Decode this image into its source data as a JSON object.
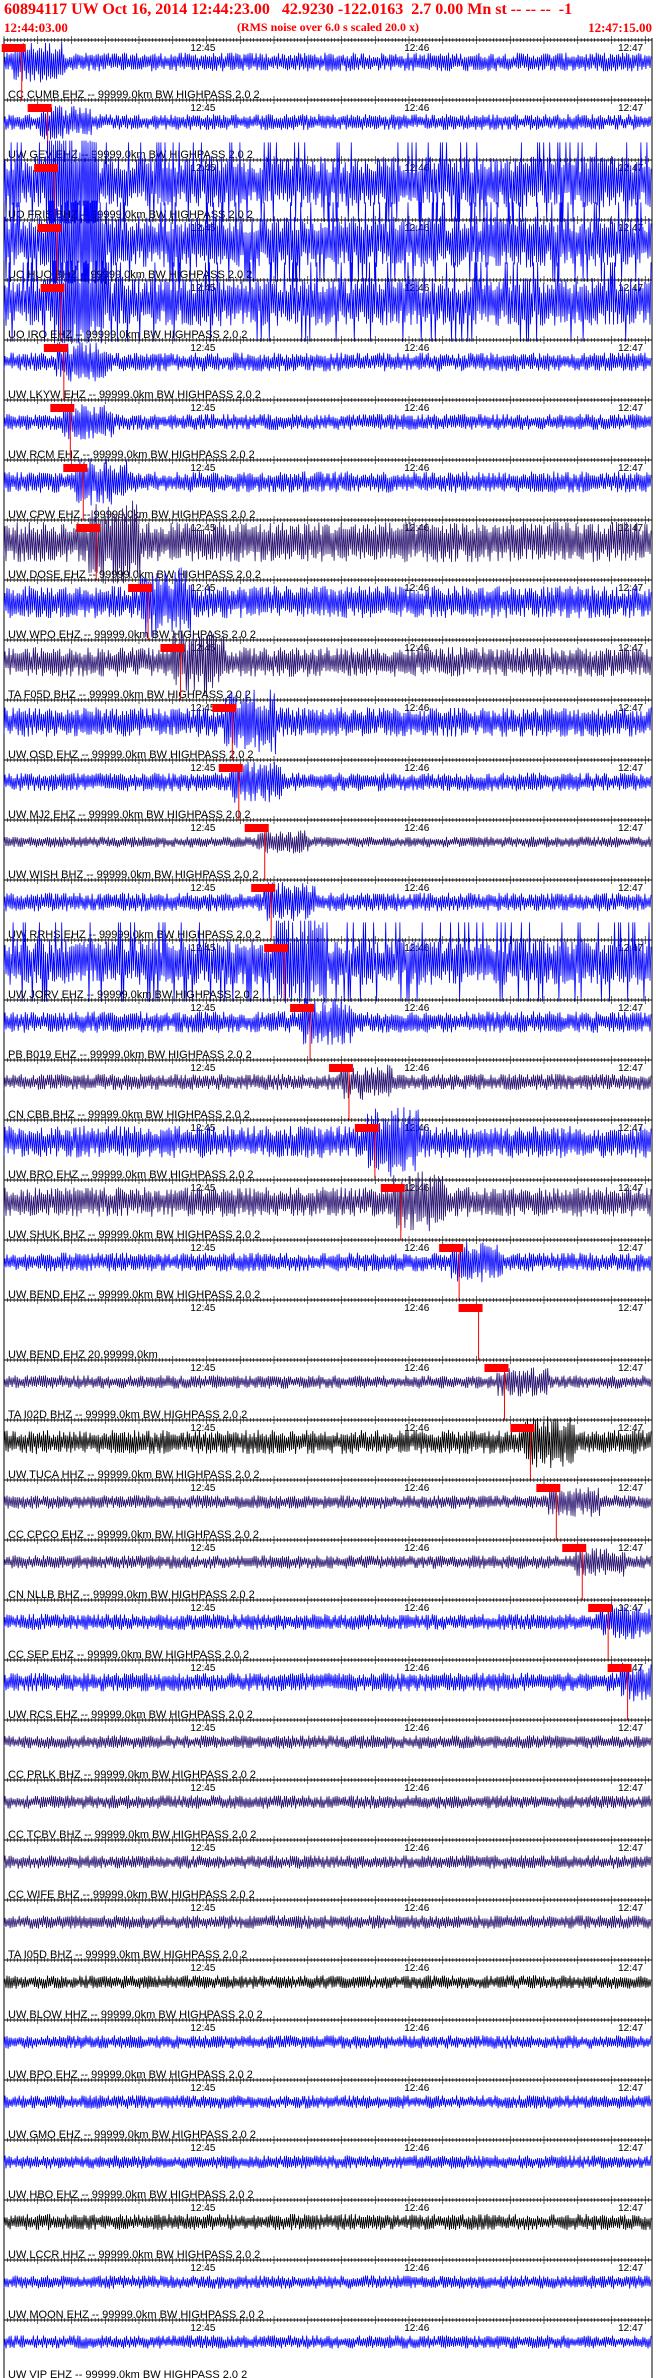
{
  "header": {
    "title": "60894117 UW Oct 16, 2014 12:44:23.00   42.9230 -122.0163  2.7 0.00 Mn st -- -- --  -1",
    "start_time": "12:44:03.00",
    "end_time": "12:47:15.00",
    "note": "(RMS noise over 6.0 s scaled 20.0 x)"
  },
  "colors": {
    "blue": "#0000ff",
    "navy": "#2a1470",
    "black": "#000000",
    "pick": "#ff0000"
  },
  "chart_data": {
    "type": "line",
    "title": "60894117 UW Oct 16, 2014 12:44:23.00   42.9230 -122.0163  2.7 0.00 Mn st -- -- --  -1",
    "x_range": [
      "12:44:03.00",
      "12:47:15.00"
    ],
    "minute_ticks": [
      "12:45",
      "12:46",
      "12:47"
    ],
    "series": [
      {
        "label": "CC CUMB EHZ -- 99999.0km BW  HIGHPASS  2.0  2",
        "color": "blue",
        "amp": 0.35,
        "pick": 0.015
      },
      {
        "label": "UW GEV EHZ -- 99999.0km BW  HIGHPASS  2.0  2",
        "color": "blue",
        "amp": 0.3,
        "pick": 0.055
      },
      {
        "label": "UO FRIS BHZ -- 99999.0km BW  HIGHPASS  2.0  2",
        "color": "blue",
        "amp": 0.95,
        "pick": 0.065
      },
      {
        "label": "UO HUO BHZ -- 99999.0km BW  HIGHPASS  2.0  2",
        "color": "blue",
        "amp": 0.95,
        "pick": 0.07
      },
      {
        "label": "UO IRO EHZ -- 99999.0km BW  HIGHPASS  2.0  2",
        "color": "blue",
        "amp": 0.9,
        "pick": 0.075
      },
      {
        "label": "UW LKYW EHZ -- 99999.0km BW  HIGHPASS  2.0  2",
        "color": "blue",
        "amp": 0.35,
        "pick": 0.08
      },
      {
        "label": "UW RCM EHZ -- 99999.0km BW  HIGHPASS  2.0  2",
        "color": "blue",
        "amp": 0.3,
        "pick": 0.09
      },
      {
        "label": "UW CPW EHZ -- 99999.0km BW  HIGHPASS  2.0  2",
        "color": "blue",
        "amp": 0.4,
        "pick": 0.11
      },
      {
        "label": "UW DOSE EHZ -- 99999.0km BW  HIGHPASS  2.0  2",
        "color": "navy",
        "amp": 0.75,
        "pick": 0.13
      },
      {
        "label": "UW WPO EHZ -- 99999.0km BW  HIGHPASS  2.0  2",
        "color": "blue",
        "amp": 0.6,
        "pick": 0.21
      },
      {
        "label": "TA F05D BHZ -- 99999.0km BW  HIGHPASS  2.0  2",
        "color": "navy",
        "amp": 0.55,
        "pick": 0.26
      },
      {
        "label": "UW OSD EHZ -- 99999.0km BW  HIGHPASS  2.0  2",
        "color": "blue",
        "amp": 0.55,
        "pick": 0.34
      },
      {
        "label": "UW MJ2 EHZ -- 99999.0km BW  HIGHPASS  2.0  2",
        "color": "blue",
        "amp": 0.35,
        "pick": 0.35
      },
      {
        "label": "UW WISH BHZ -- 99999.0km BW  HIGHPASS  2.0  2",
        "color": "navy",
        "amp": 0.2,
        "pick": 0.39
      },
      {
        "label": "UW RRHS EHZ -- 99999.0km BW  HIGHPASS  2.0  2",
        "color": "blue",
        "amp": 0.35,
        "pick": 0.4
      },
      {
        "label": "UW JORV EHZ -- 99999.0km BW  HIGHPASS  2.0  2",
        "color": "blue",
        "amp": 0.85,
        "pick": 0.42
      },
      {
        "label": "PB B019 EHZ -- 99999.0km BW  HIGHPASS  2.0  2",
        "color": "blue",
        "amp": 0.4,
        "pick": 0.46
      },
      {
        "label": "CN CBB BHZ -- 99999.0km BW  HIGHPASS  2.0  2",
        "color": "navy",
        "amp": 0.3,
        "pick": 0.52
      },
      {
        "label": "UW BRO EHZ -- 99999.0km BW  HIGHPASS  2.0  2",
        "color": "blue",
        "amp": 0.6,
        "pick": 0.56
      },
      {
        "label": "UW SHUK BHZ -- 99999.0km BW  HIGHPASS  2.0  2",
        "color": "navy",
        "amp": 0.55,
        "pick": 0.6
      },
      {
        "label": "UW BEND EHZ -- 99999.0km BW  HIGHPASS  2.0  2",
        "color": "blue",
        "amp": 0.35,
        "pick": 0.69
      },
      {
        "label": "UW BEND EHZ 20.99999.0km",
        "color": "blue",
        "amp": 0.0,
        "pick": 0.72
      },
      {
        "label": "TA I02D BHZ -- 99999.0km BW  HIGHPASS  2.0  2",
        "color": "navy",
        "amp": 0.25,
        "pick": 0.76
      },
      {
        "label": "UW TUCA HHZ -- 99999.0km BW  HIGHPASS  2.0  2",
        "color": "black",
        "amp": 0.45,
        "pick": 0.8
      },
      {
        "label": "CC CPCO EHZ -- 99999.0km BW  HIGHPASS  2.0  2",
        "color": "navy",
        "amp": 0.25,
        "pick": 0.84
      },
      {
        "label": "CN NLLB BHZ -- 99999.0km BW  HIGHPASS  2.0  2",
        "color": "navy",
        "amp": 0.25,
        "pick": 0.88
      },
      {
        "label": "CC SEP EHZ -- 99999.0km BW  HIGHPASS  2.0  2",
        "color": "blue",
        "amp": 0.3,
        "pick": 0.92
      },
      {
        "label": "UW RCS EHZ -- 99999.0km BW  HIGHPASS  2.0  2",
        "color": "blue",
        "amp": 0.35,
        "pick": 0.95
      },
      {
        "label": "CC PRLK BHZ -- 99999.0km BW  HIGHPASS  2.0  2",
        "color": "navy",
        "amp": 0.25,
        "pick": null
      },
      {
        "label": "CC TCBV BHZ -- 99999.0km BW  HIGHPASS  2.0  2",
        "color": "navy",
        "amp": 0.25,
        "pick": null
      },
      {
        "label": "CC WIFE BHZ -- 99999.0km BW  HIGHPASS  2.0  2",
        "color": "navy",
        "amp": 0.25,
        "pick": null
      },
      {
        "label": "TA I05D BHZ -- 99999.0km BW  HIGHPASS  2.0  2",
        "color": "navy",
        "amp": 0.25,
        "pick": null
      },
      {
        "label": "UW BLOW HHZ -- 99999.0km BW  HIGHPASS  2.0  2",
        "color": "black",
        "amp": 0.25,
        "pick": null
      },
      {
        "label": "UW BPO EHZ -- 99999.0km BW  HIGHPASS  2.0  2",
        "color": "blue",
        "amp": 0.25,
        "pick": null
      },
      {
        "label": "UW GMO EHZ -- 99999.0km BW  HIGHPASS  2.0  2",
        "color": "blue",
        "amp": 0.25,
        "pick": null
      },
      {
        "label": "UW HBO EHZ -- 99999.0km BW  HIGHPASS  2.0  2",
        "color": "blue",
        "amp": 0.25,
        "pick": null
      },
      {
        "label": "UW LCCR HHZ -- 99999.0km BW  HIGHPASS  2.0  2",
        "color": "black",
        "amp": 0.3,
        "pick": null
      },
      {
        "label": "UW MOON EHZ -- 99999.0km BW  HIGHPASS  2.0  2",
        "color": "blue",
        "amp": 0.25,
        "pick": null
      },
      {
        "label": "UW VIP EHZ -- 99999.0km BW  HIGHPASS  2.0  2",
        "color": "blue",
        "amp": 0.25,
        "pick": null
      }
    ]
  }
}
